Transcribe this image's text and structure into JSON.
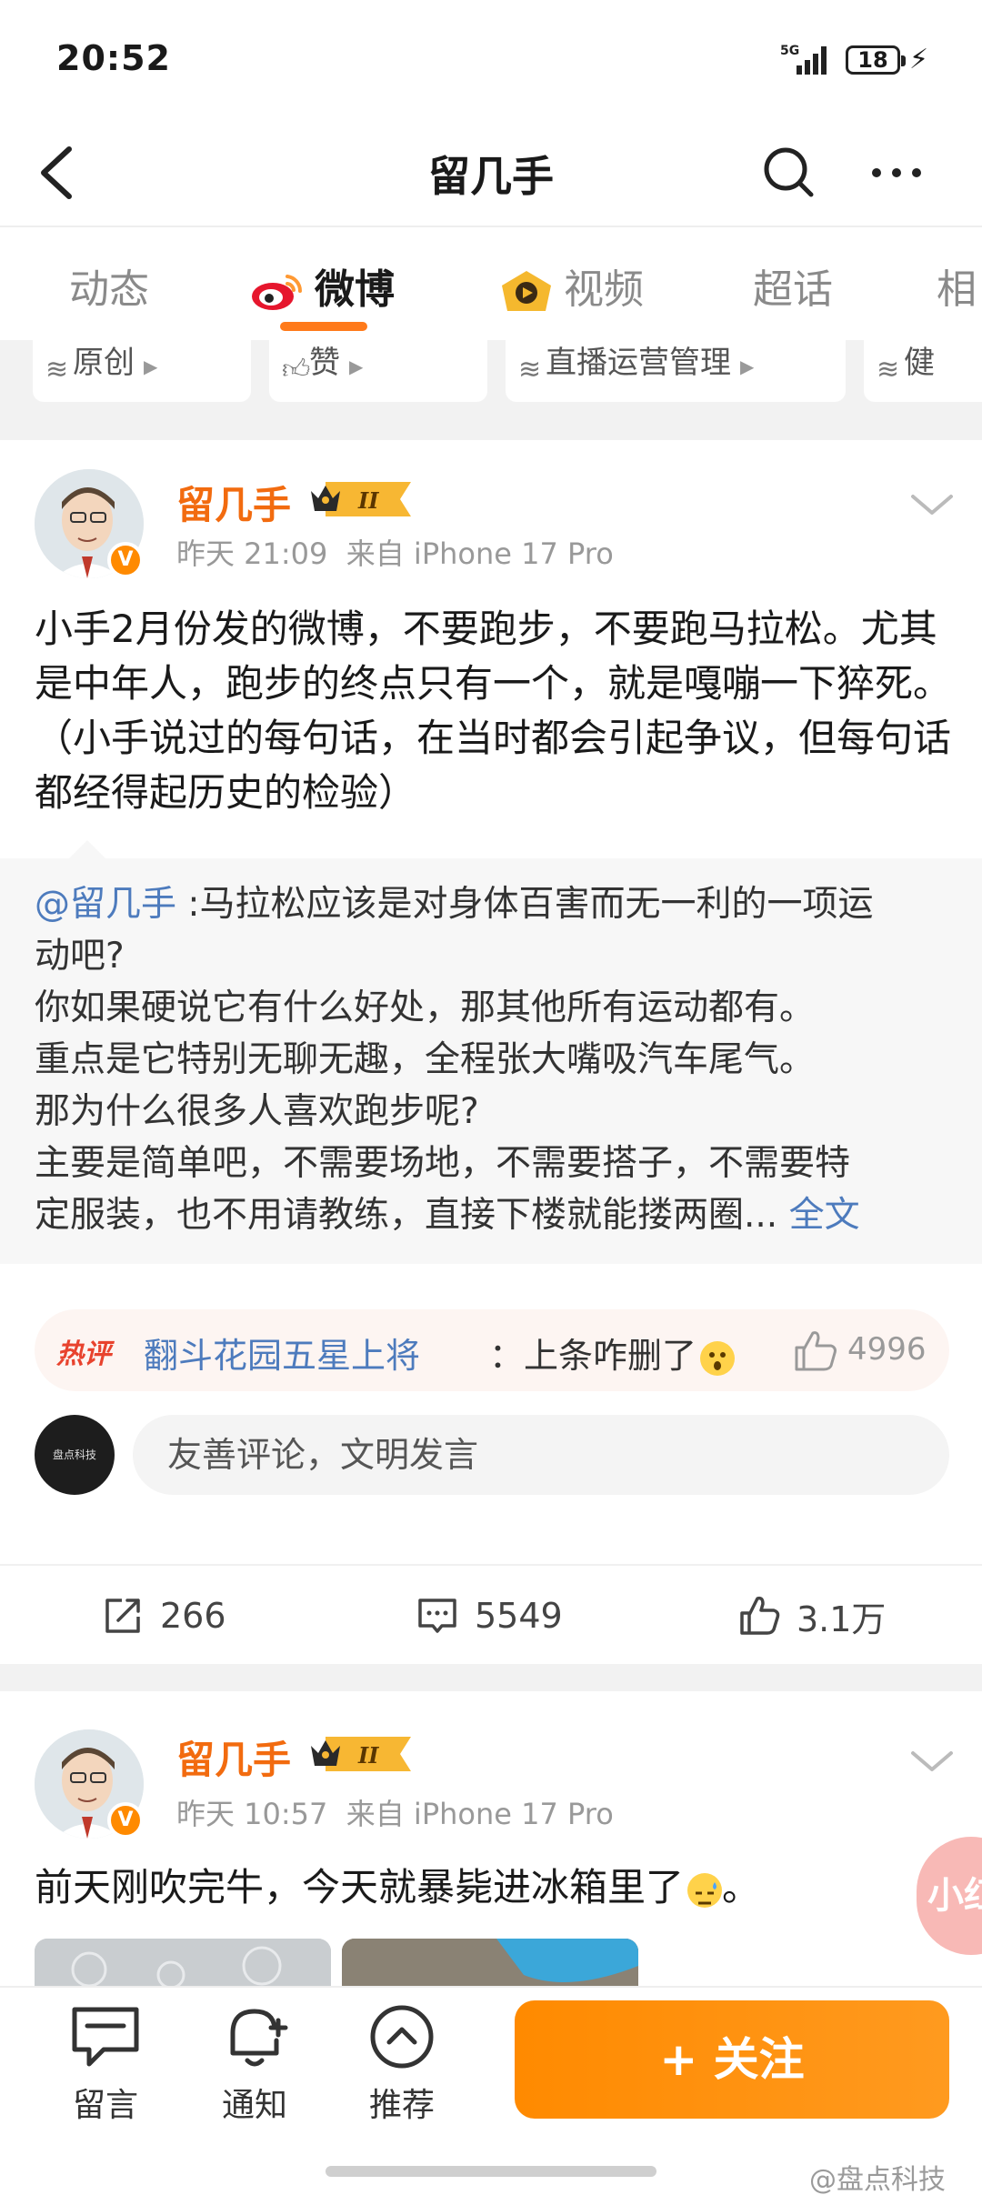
{
  "status_bar": {
    "time": "20:52",
    "network": "5G",
    "battery": "18"
  },
  "nav": {
    "title": "留几手"
  },
  "tabs": [
    {
      "label": "动态",
      "active": false
    },
    {
      "label": "微博",
      "active": true
    },
    {
      "label": "视频",
      "active": false
    },
    {
      "label": "超话",
      "active": false
    },
    {
      "label": "相",
      "active": false
    }
  ],
  "filters": [
    {
      "label": "原创",
      "icon": "layers-icon"
    },
    {
      "label": "赞",
      "icon": "thumb-icon"
    },
    {
      "label": "直播运营管理",
      "icon": "layers-icon"
    },
    {
      "label": "健",
      "icon": "layers-icon"
    }
  ],
  "posts": [
    {
      "author": "留几手",
      "level": "II",
      "time": "昨天 21:09",
      "source": "来自 iPhone 17 Pro",
      "text": "小手2月份发的微博，不要跑步，不要跑马拉松。尤其是中年人，跑步的终点只有一个，就是嘎嘣一下猝死。（小手说过的每句话，在当时都会引起争议，但每句话都经得起历史的检验）",
      "quote": {
        "mention": "@留几手",
        "line1": " :马拉松应该是对身体百害而无一利的一项运",
        "lines": [
          "动吧?",
          "你如果硬说它有什么好处，那其他所有运动都有。",
          "重点是它特别无聊无趣，全程张大嘴吸汽车尾气。",
          "那为什么很多人喜欢跑步呢?",
          "主要是简单吧，不需要场地，不需要搭子，不需要特"
        ],
        "last_line": "定服装，也不用请教练，直接下楼就能搂两圈...",
        "full_text_link": "全文"
      },
      "hot_comment": {
        "tag": "热评",
        "user": "翻斗花园五星上将",
        "text": "：上条咋删了",
        "likes": "4996"
      },
      "comment_placeholder": "友善评论，文明发言",
      "my_avatar_text": "盘点科技",
      "reposts": "266",
      "comments": "5549",
      "likes": "3.1万"
    },
    {
      "author": "留几手",
      "level": "II",
      "time": "昨天 10:57",
      "source": "来自 iPhone 17 Pro",
      "text": "前天刚吹完牛，今天就暴毙进冰箱里了",
      "text_end": "。"
    }
  ],
  "floating_badge": "小红",
  "bottom_bar": {
    "message": "留言",
    "notify": "通知",
    "recommend": "推荐",
    "follow": "+ 关注"
  },
  "watermark": "@盘点科技",
  "colors": {
    "accent": "#ff8a00",
    "link": "#4d7bbd",
    "author": "#f26b0f",
    "hot": "#e8432e"
  }
}
